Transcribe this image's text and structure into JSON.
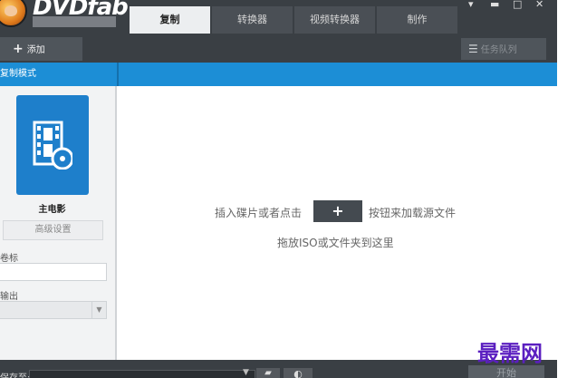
{
  "app": {
    "brand": "DVDfab"
  },
  "tabs": [
    {
      "label": "复制",
      "active": true
    },
    {
      "label": "转换器",
      "active": false
    },
    {
      "label": "视频转换器",
      "active": false
    },
    {
      "label": "制作",
      "active": false
    }
  ],
  "window_controls": {
    "menu": "▾",
    "minimize": "▬",
    "maximize": "□",
    "close": "✕"
  },
  "toolbar": {
    "add_icon": "+",
    "add_label": "添加",
    "queue_icon": "list-icon",
    "queue_label": "任务队列"
  },
  "mode_bar": {
    "label": "复制模式"
  },
  "left_panel": {
    "mode_icon": "film-disc-icon",
    "mode_label": "主电影",
    "advanced_button": "高级设置",
    "volume_label": "卷标",
    "volume_value": "",
    "output_label": "输出",
    "output_value": ""
  },
  "main": {
    "hint_before": "插入碟片或者点击",
    "plus_button": "+",
    "hint_after": "按钮来加载源文件",
    "hint_drag": "拖放ISO或文件夹到这里"
  },
  "bottom": {
    "save_label": "保存至:",
    "save_value": "",
    "folder_icon": "folder-icon",
    "iso_icon": "iso-icon",
    "start_button": "开始"
  },
  "watermark": "最需网",
  "colors": {
    "titlebar": "#3a3f44",
    "accent_blue": "#1c8ed6",
    "tile_blue": "#1e7fcb",
    "watermark": "#5b1fc0"
  }
}
